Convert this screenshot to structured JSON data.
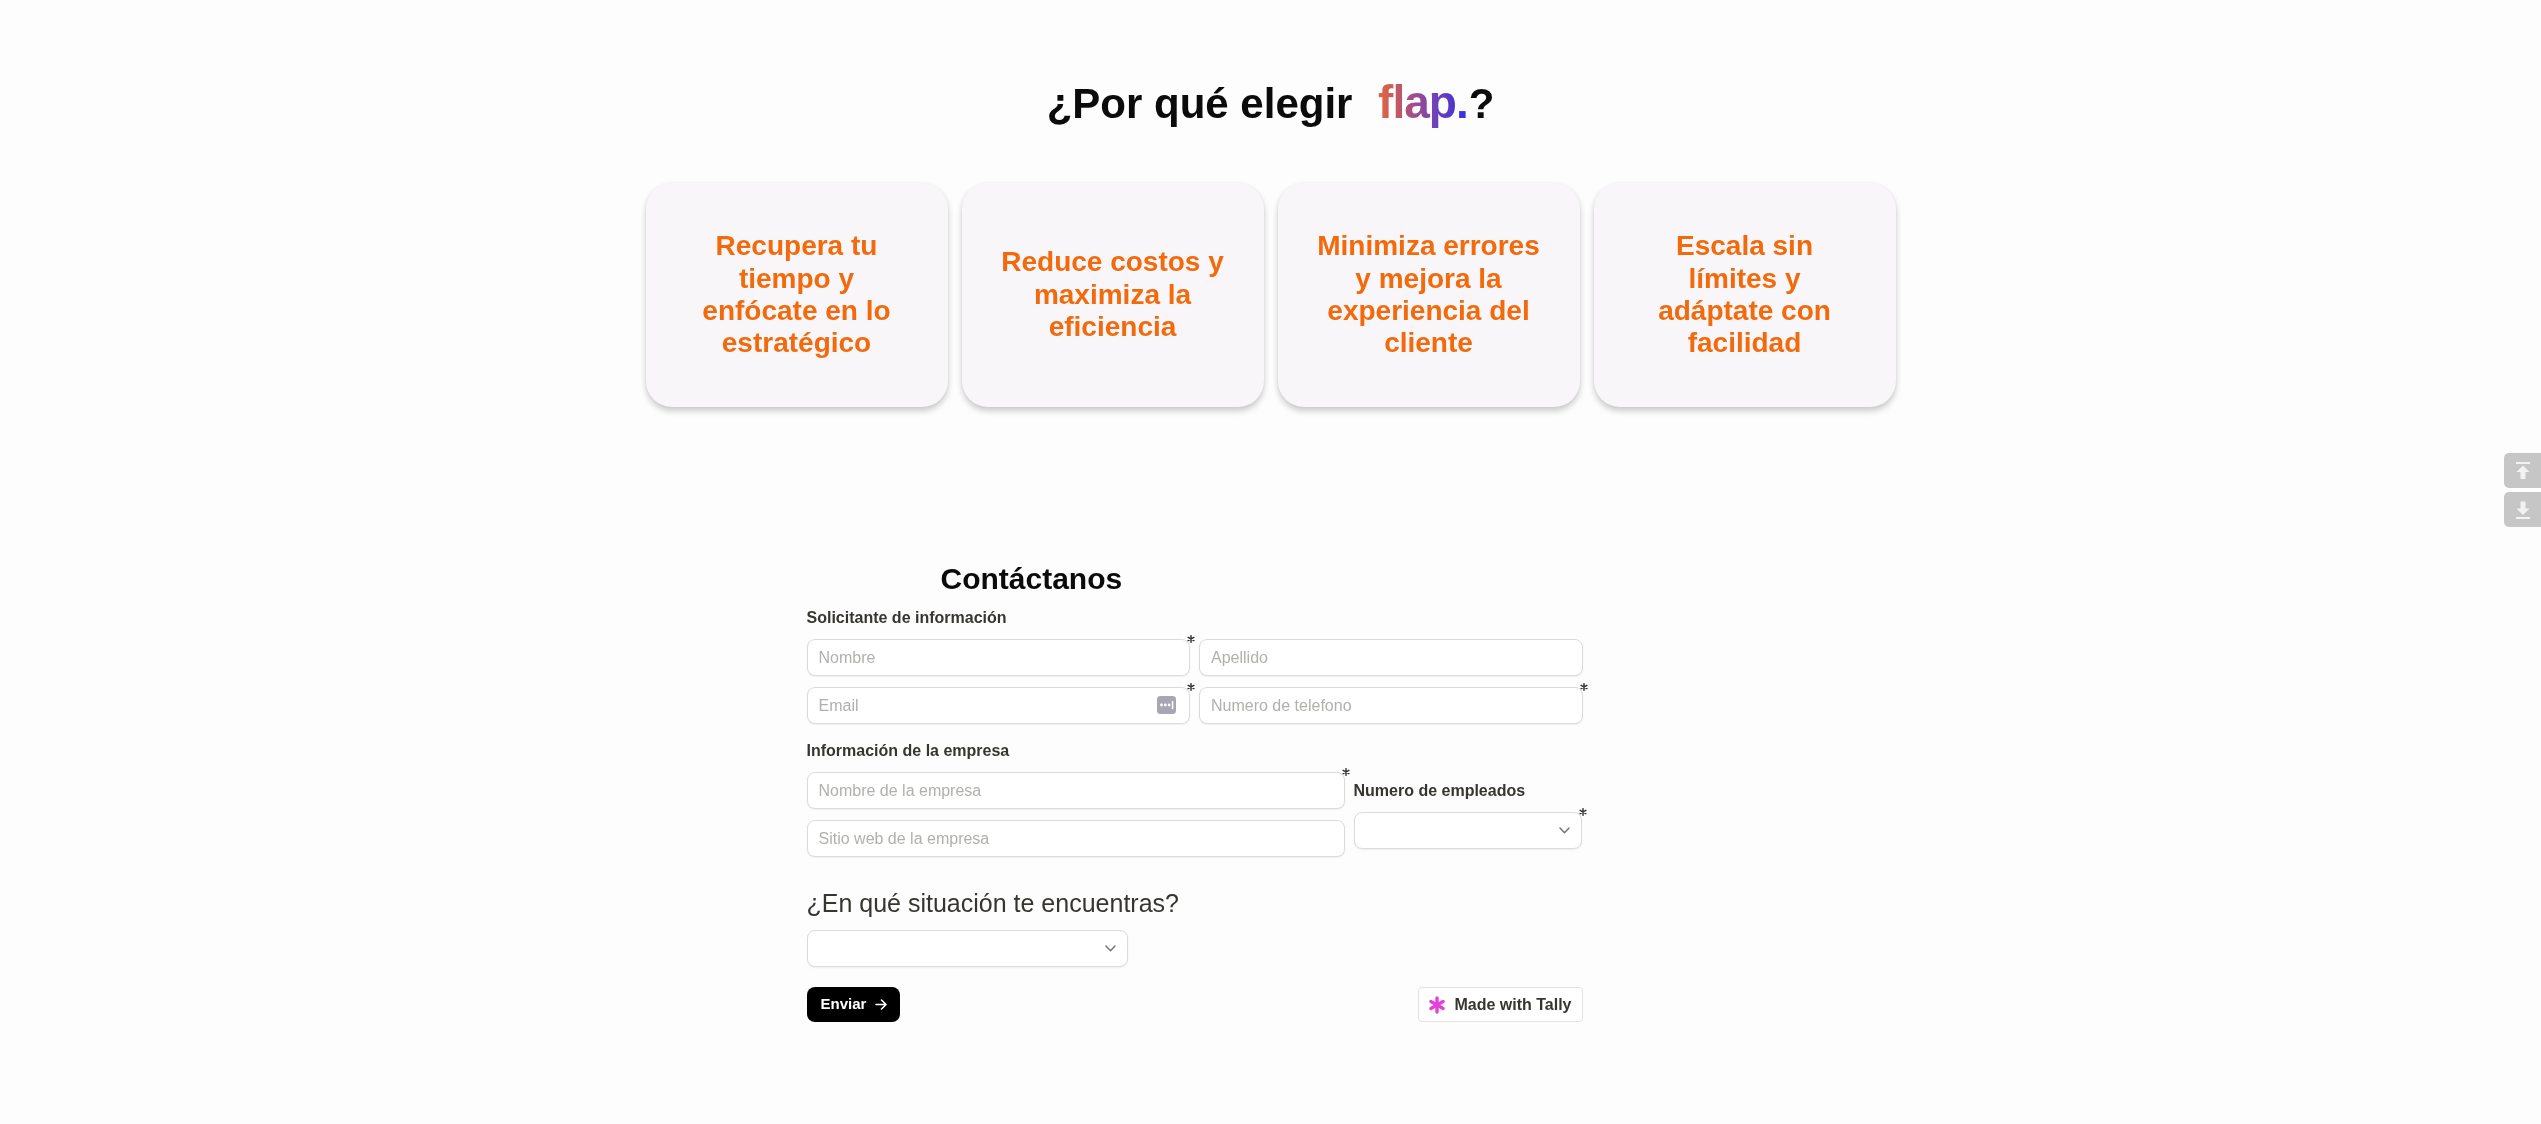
{
  "heading": {
    "prefix": "¿Por qué elegir",
    "logo": "flap",
    "logo_dot": ".",
    "suffix": "?"
  },
  "benefits": [
    "Recupera tu tiempo y enfócate en lo estratégico",
    "Reduce costos y maximiza la eficiencia",
    "Minimiza errores y mejora la experiencia del cliente",
    "Escala sin límites y adáptate con facilidad"
  ],
  "contact_form": {
    "title": "Contáctanos",
    "applicant": {
      "label": "Solicitante de información",
      "fields": [
        {
          "placeholder": "Nombre",
          "required": true,
          "kind": "text"
        },
        {
          "placeholder": "Apellido",
          "required": false,
          "kind": "text"
        },
        {
          "placeholder": "Email",
          "required": true,
          "kind": "autofill"
        },
        {
          "placeholder": "Numero de telefono",
          "required": true,
          "kind": "text"
        }
      ]
    },
    "company": {
      "label": "Información de la empresa",
      "fields": [
        {
          "placeholder": "Nombre de la empresa",
          "required": true
        },
        {
          "placeholder": "Sitio web de la empresa",
          "required": false
        }
      ],
      "employees": {
        "label": "Numero de empleados",
        "required": true
      }
    },
    "situation": {
      "question": "¿En qué situación te encuentras?"
    },
    "submit": "Enviar",
    "badge": "Made with Tally"
  }
}
